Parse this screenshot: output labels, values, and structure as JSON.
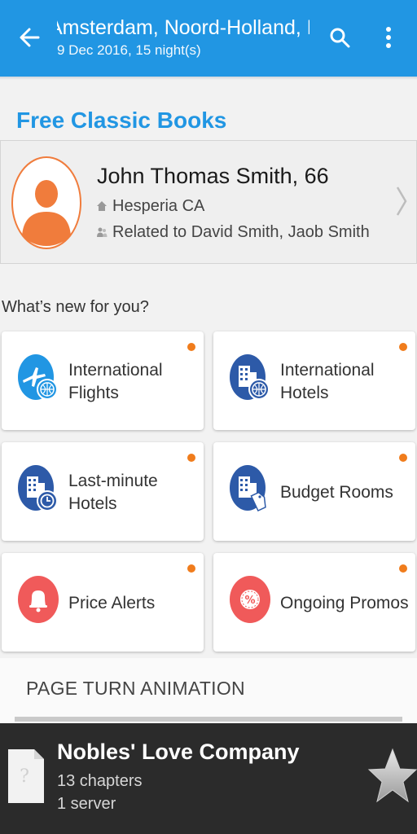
{
  "appbar": {
    "title": "Amsterdam, Noord-Holland, Netherlands",
    "subtitle": "9 Dec 2016, 15 night(s)",
    "bg_color": "#2196e3"
  },
  "section_title": "Free Classic Books",
  "profile": {
    "name": "John Thomas Smith, 66",
    "location": "Hesperia CA",
    "related": "Related to David Smith, Jaob Smith",
    "avatar_color": "#f07c3c"
  },
  "whats_new_label": "What’s new for you?",
  "tiles": [
    {
      "line1": "International",
      "line2": "Flights",
      "icon": "flight-globe-icon",
      "color": "#2196e3"
    },
    {
      "line1": "International",
      "line2": "Hotels",
      "icon": "hotel-globe-icon",
      "color": "#2d5aa8"
    },
    {
      "line1": "Last-minute",
      "line2": "Hotels",
      "icon": "hotel-clock-icon",
      "color": "#2d5aa8"
    },
    {
      "line1": "Budget Rooms",
      "line2": "",
      "icon": "hotel-tag-icon",
      "color": "#2d5aa8"
    },
    {
      "line1": "Price Alerts",
      "line2": "",
      "icon": "bell-icon",
      "color": "#f05a5a"
    },
    {
      "line1": "Ongoing Promos",
      "line2": "",
      "icon": "percent-badge-icon",
      "color": "#f05a5a"
    }
  ],
  "indicator_color": "#f07c1c",
  "page_turn_label": "PAGE TURN ANIMATION",
  "player": {
    "title": "Nobles' Love Company",
    "chapters": "13 chapters",
    "server": "1 server"
  }
}
